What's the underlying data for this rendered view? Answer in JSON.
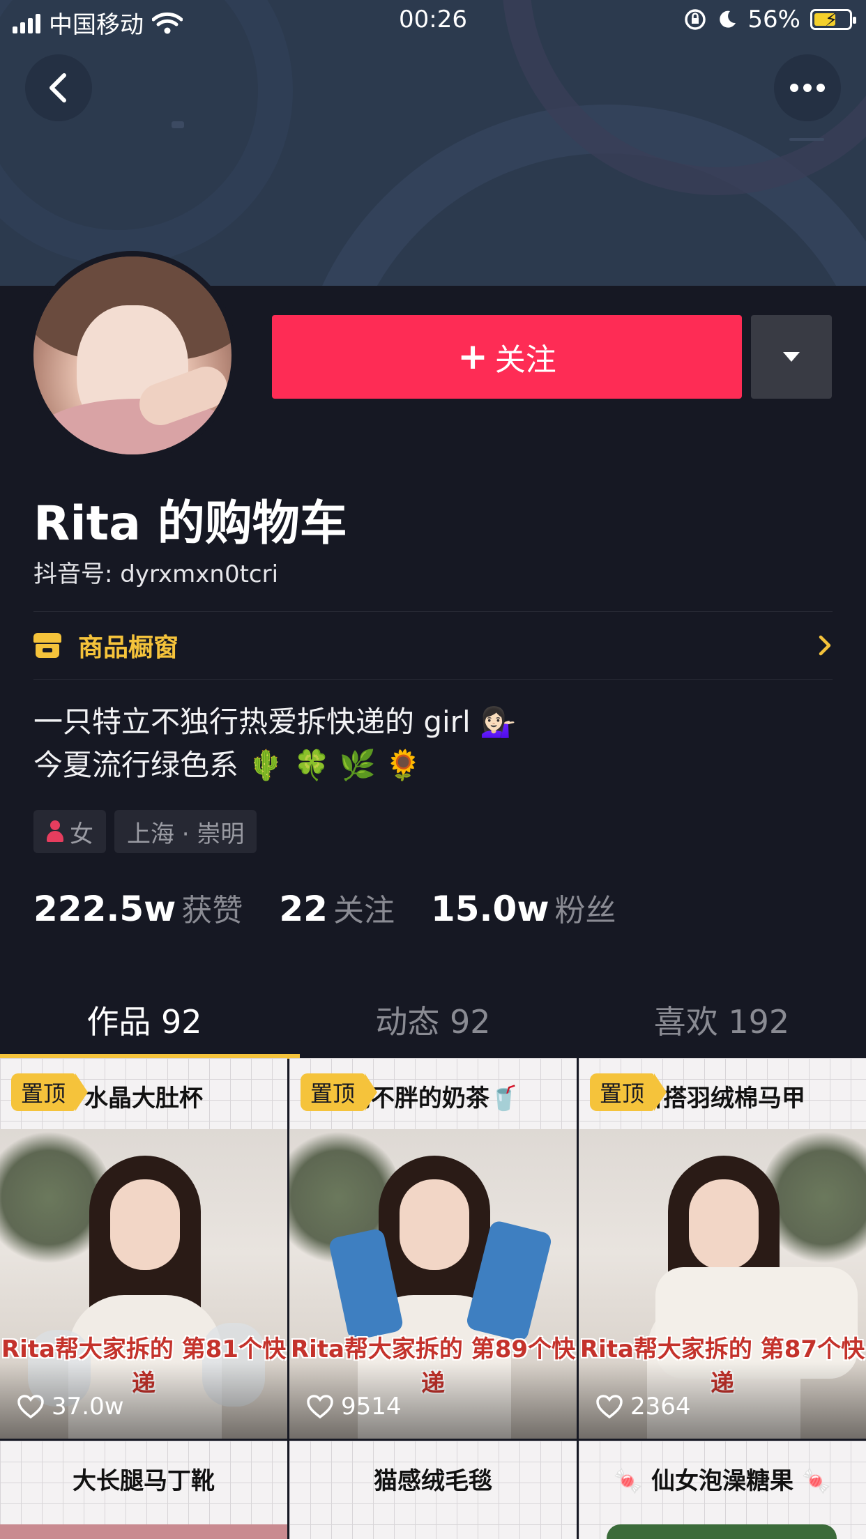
{
  "status_bar": {
    "carrier": "中国移动",
    "time": "00:26",
    "battery": "56%"
  },
  "profile": {
    "name": "Rita 的购物车",
    "douyin_id": "抖音号: dyrxmxn0tcri",
    "follow_label": "关注",
    "shop_label": "商品橱窗",
    "bio_line1": "一只特立不独行热爱拆快递的 girl 💁🏻‍♀️",
    "bio_line2": "今夏流行绿色系 🌵 🍀 🌿 🌻",
    "tags": {
      "gender": "女",
      "location": "上海 · 崇明"
    },
    "stats": {
      "likes_num": "222.5w",
      "likes_label": "获赞",
      "following_num": "22",
      "following_label": "关注",
      "fans_num": "15.0w",
      "fans_label": "粉丝"
    }
  },
  "tabs": [
    {
      "label": "作品 92",
      "active": true
    },
    {
      "label": "动态 92",
      "active": false
    },
    {
      "label": "喜欢 192",
      "active": false
    }
  ],
  "videos": [
    {
      "pinned": "置顶",
      "title": "水晶大肚杯",
      "overlay": "Rita帮大家拆的 第81个快递",
      "likes": "37.0w"
    },
    {
      "pinned": "置顶",
      "title": "喝不胖的奶茶🥤",
      "overlay": "Rita帮大家拆的 第89个快递",
      "likes": "9514"
    },
    {
      "pinned": "置顶",
      "title": "百搭羽绒棉马甲",
      "overlay": "Rita帮大家拆的 第87个快递",
      "likes": "2364"
    },
    {
      "title": "大长腿马丁靴"
    },
    {
      "title": "猫感绒毛毯"
    },
    {
      "title": "🍬 仙女泡澡糖果 🍬"
    }
  ],
  "colors": {
    "background": "#161823",
    "follow_button": "#fe2c55",
    "accent_yellow": "#f5c33b"
  },
  "icons": {
    "back": "chevron-left-icon",
    "more": "ellipsis-icon",
    "dropdown": "triangle-down-icon",
    "shop": "storefront-icon",
    "like": "heart-outline-icon"
  }
}
